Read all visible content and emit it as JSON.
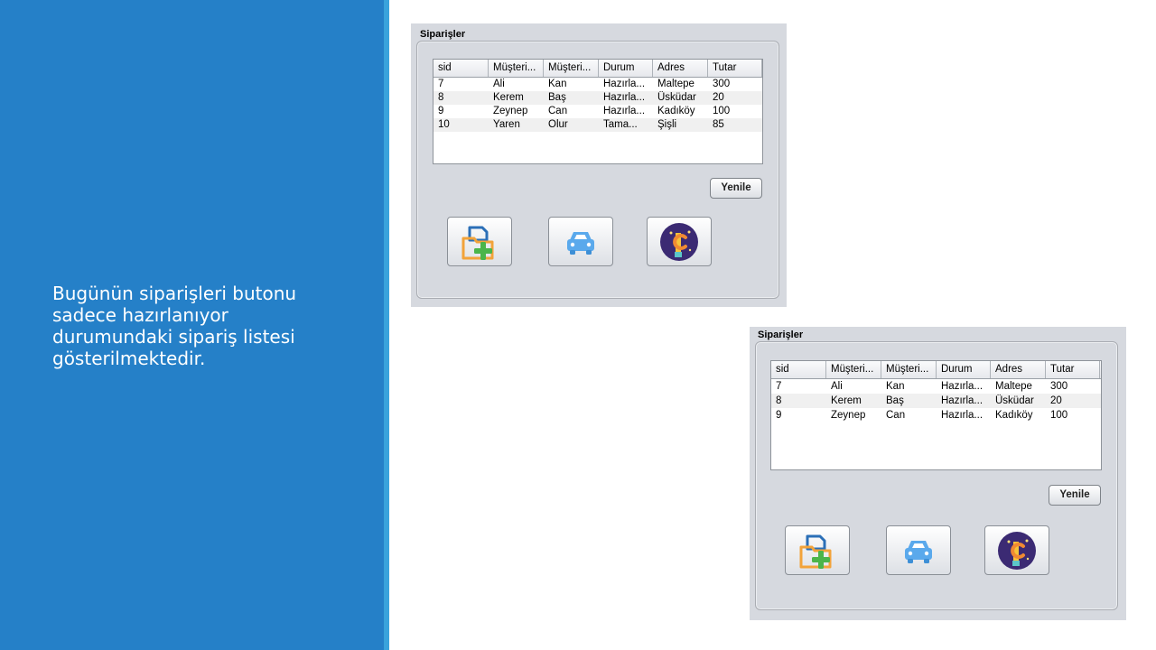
{
  "slide": {
    "caption": "Bugünün siparişleri butonu\nsadece hazırlanıyor\ndurumundaki sipariş listesi\ngösterilmektedir."
  },
  "colors": {
    "left_panel": "#2580c8",
    "stripe": "#3aa3dc",
    "window_bg": "#d6d9df"
  },
  "columns": [
    "sid",
    "Müşteri...",
    "Müşteri...",
    "Durum",
    "Adres",
    "Tutar"
  ],
  "screenshot_before": {
    "title": "Siparişler",
    "rows": [
      [
        "7",
        "Ali",
        "Kan",
        "Hazırla...",
        "Maltepe",
        "300"
      ],
      [
        "8",
        "Kerem",
        "Baş",
        "Hazırla...",
        "Üsküdar",
        "20"
      ],
      [
        "9",
        "Zeynep",
        "Can",
        "Hazırla...",
        "Kadıköy",
        "100"
      ],
      [
        "10",
        "Yaren",
        "Olur",
        "Tama...",
        "Şişli",
        "85"
      ]
    ],
    "refresh_label": "Yenile",
    "icon_buttons": [
      "new-order-folder-icon",
      "car-icon",
      "rocket-c-icon"
    ]
  },
  "screenshot_after": {
    "title": "Siparişler",
    "rows": [
      [
        "7",
        "Ali",
        "Kan",
        "Hazırla...",
        "Maltepe",
        "300"
      ],
      [
        "8",
        "Kerem",
        "Baş",
        "Hazırla...",
        "Üsküdar",
        "20"
      ],
      [
        "9",
        "Zeynep",
        "Can",
        "Hazırla...",
        "Kadıköy",
        "100"
      ]
    ],
    "refresh_label": "Yenile",
    "icon_buttons": [
      "new-order-folder-icon",
      "car-icon",
      "rocket-c-icon"
    ]
  }
}
